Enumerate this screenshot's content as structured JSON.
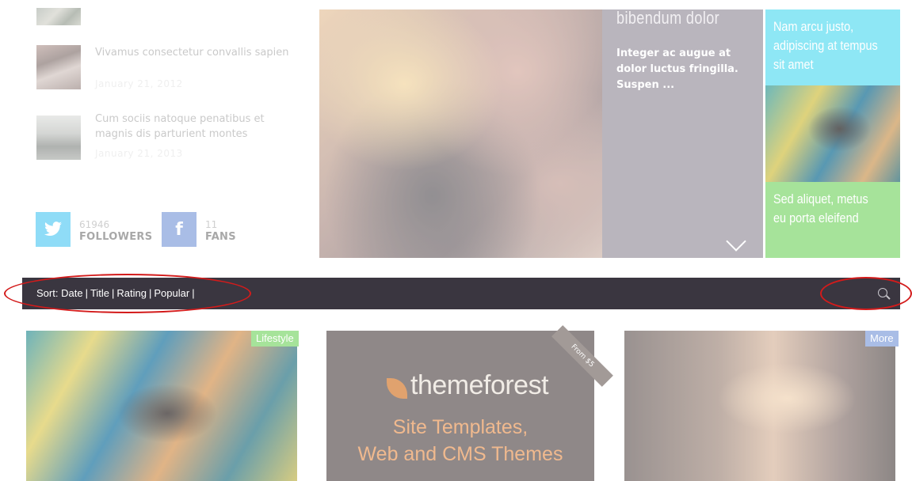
{
  "recent_posts": [
    {
      "title": "Vivamus consectetur convallis sapien",
      "date": "January 21, 2012"
    },
    {
      "title": "Cum sociis natoque penatibus et magnis dis parturient montes",
      "date": "January 21, 2013"
    }
  ],
  "social": {
    "twitter": {
      "count": "61946",
      "label": "FOLLOWERS",
      "icon": "twitter-bird-icon"
    },
    "facebook": {
      "count": "11",
      "label": "FANS",
      "icon": "facebook-f-icon",
      "glyph": "f"
    }
  },
  "featured": {
    "title": "bibendum dolor",
    "excerpt": "Integer ac augue at dolor luctus fringilla. Suspen ...",
    "side_top": "Nam arcu justo, adipiscing at tempus sit amet",
    "side_bottom": "Sed aliquet, metus eu porta eleifend"
  },
  "sortbar": {
    "prefix": "Sort:",
    "options": [
      "Date",
      "Title",
      "Rating",
      "Popular"
    ]
  },
  "cards": [
    {
      "badge": "Lifestyle"
    },
    {
      "ribbon": "From $5",
      "brand": "themeforest",
      "line1": "Site Templates,",
      "line2": "Web and CMS Themes"
    },
    {
      "badge": "More"
    }
  ],
  "colors": {
    "sortbar_bg": "#3a3640",
    "accent_cyan": "#8ee7f5",
    "accent_green": "#a6e39a",
    "accent_blue": "#a9bde6",
    "annotation_red": "#d31b1b"
  }
}
